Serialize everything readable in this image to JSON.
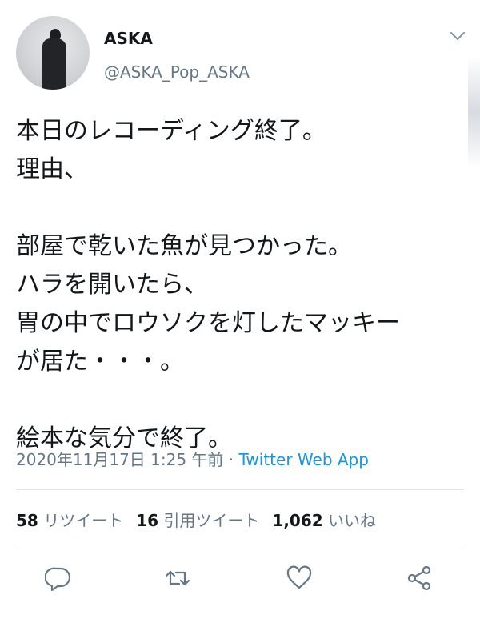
{
  "author": {
    "name": "ASKA",
    "handle": "@ASKA_Pop_ASKA"
  },
  "tweet": {
    "lines": [
      "本日のレコーディング終了。",
      "理由、",
      "",
      "部屋で乾いた魚が見つかった。",
      "ハラを開いたら、",
      "胃の中でロウソクを灯したマッキー",
      "が居た・・・。",
      "",
      "絵本な気分で終了。"
    ],
    "timestamp": "2020年11月17日 1:25 午前",
    "separator": " · ",
    "source": "Twitter Web App"
  },
  "stats": {
    "retweets_count": "58",
    "retweets_label": "リツイート",
    "quotes_count": "16",
    "quotes_label": "引用ツイート",
    "likes_count": "1,062",
    "likes_label": "いいね"
  },
  "icons": {
    "menu": "chevron-down-icon",
    "reply": "reply-icon",
    "retweet": "retweet-icon",
    "like": "heart-icon",
    "share": "share-icon"
  },
  "colors": {
    "text": "#14171a",
    "secondary": "#657786",
    "link": "#1b95e0",
    "divider": "#e1e8ed"
  }
}
